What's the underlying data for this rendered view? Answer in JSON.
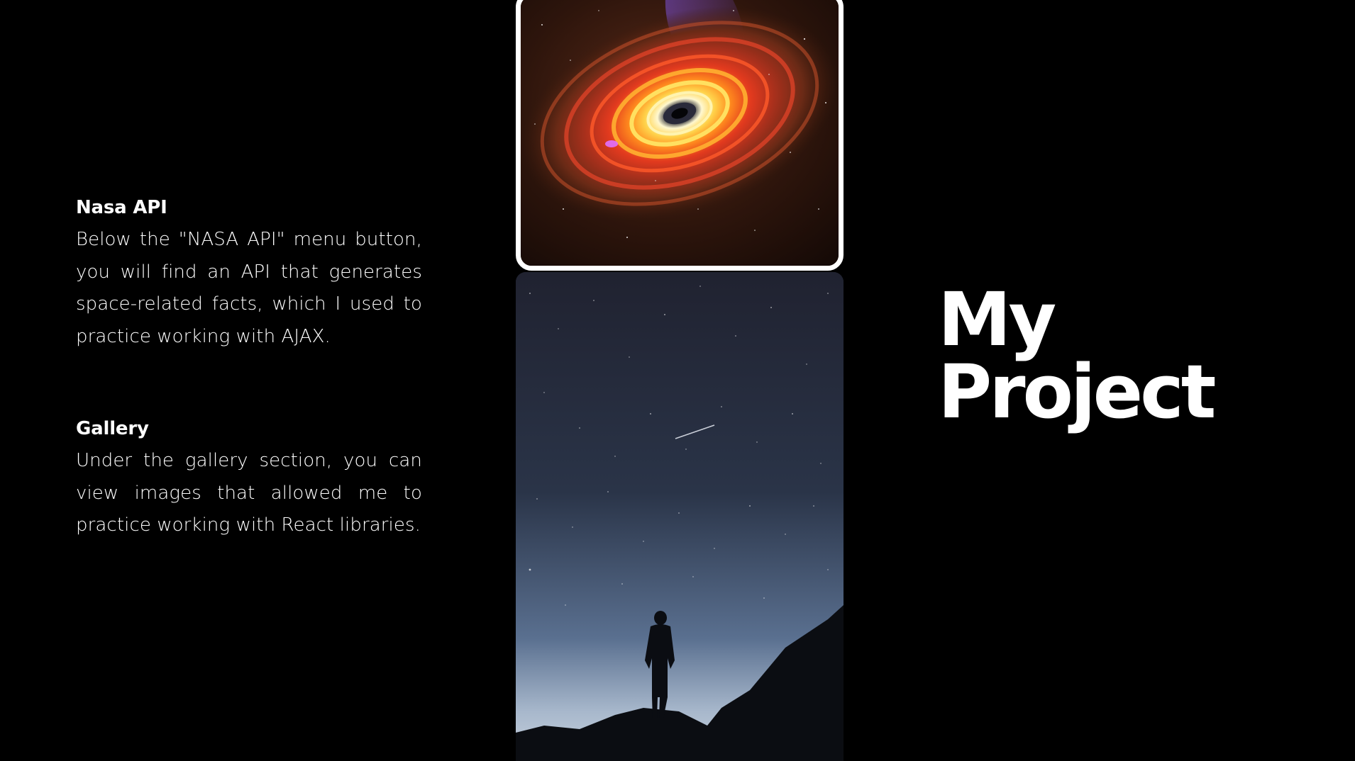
{
  "sections": [
    {
      "heading": "Nasa API",
      "body": "Below the \"NASA API\" menu button, you will find an API that generates space-related facts, which I used to practice working with AJAX."
    },
    {
      "heading": "Gallery",
      "body": "Under the gallery section, you can view images that allowed me to practice working with React libraries."
    }
  ],
  "title": {
    "line1": "My",
    "line2": "Project"
  },
  "images": {
    "top": "black-hole-galaxy-image",
    "bottom": "night-sky-silhouette-image"
  },
  "colors": {
    "background": "#000000",
    "text": "#ffffff",
    "frame": "#ffffff"
  }
}
